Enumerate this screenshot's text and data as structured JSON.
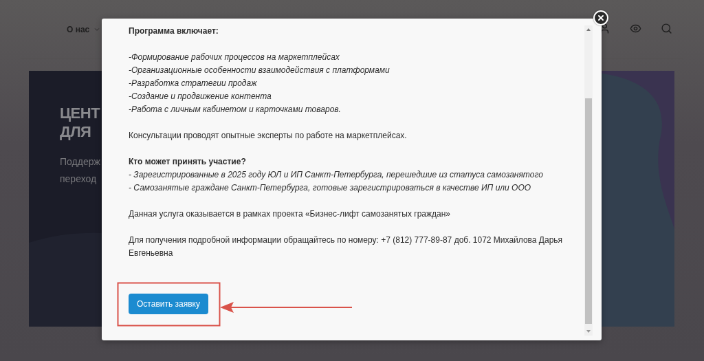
{
  "nav": {
    "menu_item": "О нас"
  },
  "hero": {
    "title_lines": [
      "ЦЕНТ",
      "ДЛЯ"
    ],
    "subtitle_lines": [
      "Поддерж",
      "переход"
    ]
  },
  "modal": {
    "blocks": [
      {
        "kind": "heading",
        "text": "Программа включает:"
      },
      {
        "kind": "list",
        "items": [
          "-Формирование рабочих процессов на маркетплейсах",
          "-Организационные особенности взаимодействия с платформами",
          "-Разработка стратегии продаж",
          "-Создание и продвижение контента",
          "-Работа с личным кабинетом и карточками товаров."
        ]
      },
      {
        "kind": "paragraph",
        "text": "Консультации проводят опытные эксперты по работе на маркетплейсах."
      },
      {
        "kind": "titled_list",
        "title": "Кто может принять участие?",
        "items": [
          "- Зарегистрированные в 2025 году ЮЛ и ИП Санкт-Петербурга, перешедшие из статуса самозанятого",
          "- Самозанятые граждане Санкт-Петербурга, готовые зарегистрироваться в качестве ИП или ООО"
        ]
      },
      {
        "kind": "paragraph",
        "text": "Данная услуга оказывается в рамках проекта «Бизнес-лифт самозанятых граждан»"
      },
      {
        "kind": "paragraph",
        "text": "Для получения подробной информации обращайтесь по номеру: +7 (812) 777-89-87 доб. 1072 Михайлова Дарья Евгеньевна"
      }
    ],
    "button": "Оставить заявку"
  }
}
